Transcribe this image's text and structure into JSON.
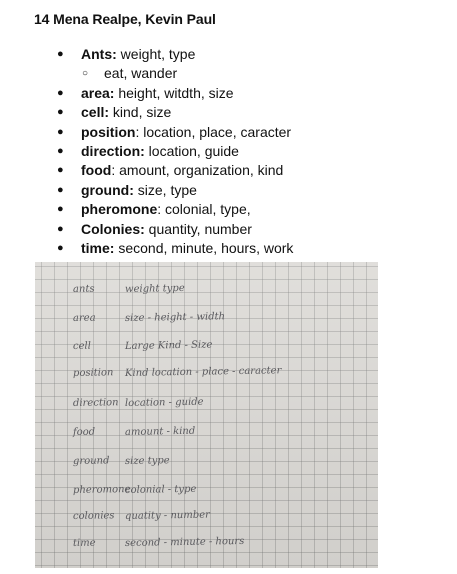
{
  "document": {
    "title": "14 Mena Realpe, Kevin Paul"
  },
  "outline": [
    {
      "term": "Ants:",
      "desc": " weight, type",
      "sub": [
        "eat, wander"
      ]
    },
    {
      "term": "area:",
      "desc": " height, witdth, size"
    },
    {
      "term": "cell:",
      "desc": " kind, size"
    },
    {
      "term": "position",
      "desc": ": location, place, caracter"
    },
    {
      "term": "direction:",
      "desc": " location, guide"
    },
    {
      "term": "food",
      "desc": ": amount, organization, kind"
    },
    {
      "term": "ground:",
      "desc": " size, type"
    },
    {
      "term": "pheromone",
      "desc": ": colonial, type,"
    },
    {
      "term": "Colonies:",
      "desc": " quantity, number"
    },
    {
      "term": "time:",
      "desc": " second, minute, hours, work"
    }
  ],
  "handwritten_note": {
    "rows": [
      {
        "term": "ants",
        "desc": "weight  type"
      },
      {
        "term": "area",
        "desc": "size - height - width"
      },
      {
        "term": "cell",
        "desc": "Large  Kind - Size"
      },
      {
        "term": "position",
        "desc": "Kind  location - place - caracter"
      },
      {
        "term": "direction",
        "desc": "location - guide"
      },
      {
        "term": "food",
        "desc": "amount - kind"
      },
      {
        "term": "ground",
        "desc": "size  type"
      },
      {
        "term": "pheromone",
        "desc": "colonial - type"
      },
      {
        "term": "colonies",
        "desc": "quatity - number"
      },
      {
        "term": "time",
        "desc": "second - minute - hours"
      }
    ]
  }
}
